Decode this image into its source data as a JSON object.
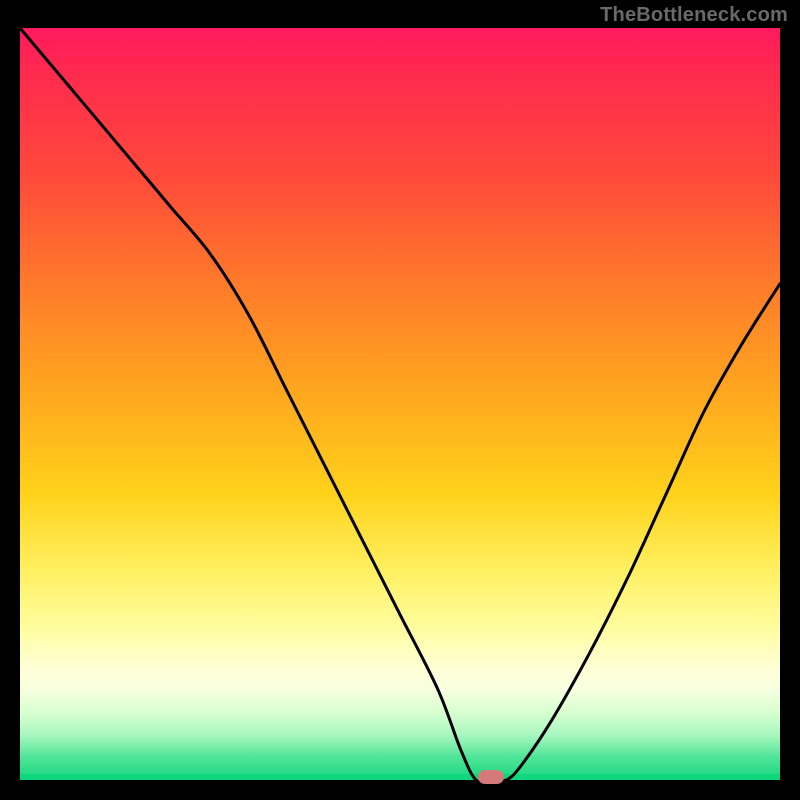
{
  "watermark": "TheBottleneck.com",
  "marker": {
    "x_pct": 62,
    "y_pct": 100,
    "color": "#d47a7a"
  },
  "chart_data": {
    "type": "line",
    "title": "",
    "xlabel": "",
    "ylabel": "",
    "xlim": [
      0,
      100
    ],
    "ylim": [
      0,
      100
    ],
    "grid": false,
    "legend": false,
    "series": [
      {
        "name": "curve",
        "x": [
          0,
          5,
          10,
          15,
          20,
          25,
          30,
          35,
          40,
          45,
          50,
          55,
          58,
          60,
          62,
          64,
          66,
          70,
          75,
          80,
          85,
          90,
          95,
          100
        ],
        "y": [
          100,
          94,
          88,
          82,
          76,
          70,
          62,
          52,
          42,
          32,
          22,
          12,
          4,
          0,
          0,
          0,
          2,
          8,
          17,
          27,
          38,
          49,
          58,
          66
        ]
      }
    ],
    "annotations": [
      {
        "text": "TheBottleneck.com",
        "position": "top-right"
      }
    ]
  }
}
